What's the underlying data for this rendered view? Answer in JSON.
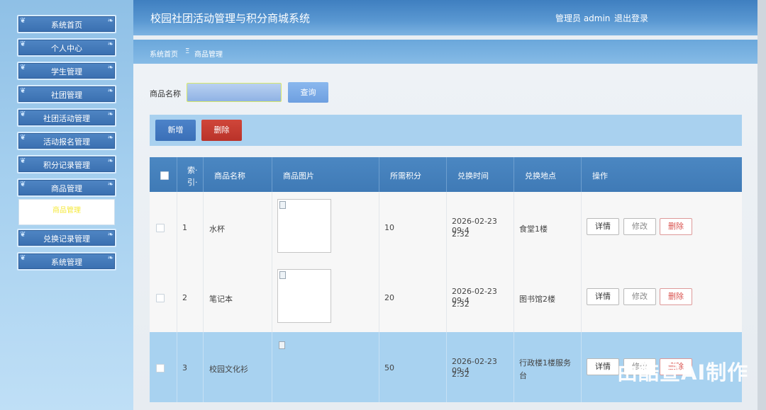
{
  "header": {
    "title": "校园社团活动管理与积分商城系统",
    "user": "管理员 admin",
    "logout": "退出登录"
  },
  "sidebar": {
    "items": [
      {
        "label": "系统首页"
      },
      {
        "label": "个人中心"
      },
      {
        "label": "学生管理"
      },
      {
        "label": "社团管理"
      },
      {
        "label": "社团活动管理"
      },
      {
        "label": "活动报名管理"
      },
      {
        "label": "积分记录管理"
      },
      {
        "label": "商品管理"
      },
      {
        "label": "兑换记录管理"
      },
      {
        "label": "系统管理"
      }
    ],
    "submenu_label": "商品管理"
  },
  "breadcrumb": {
    "home": "系统首页",
    "separator": "Ξ",
    "current": "商品管理"
  },
  "search": {
    "label": "商品名称",
    "value": "",
    "query_label": "查询"
  },
  "toolbar": {
    "add_label": "新增",
    "delete_label": "删除"
  },
  "table": {
    "columns": [
      "索引",
      "商品名称",
      "商品图片",
      "所需积分",
      "兑换时间",
      "兑换地点",
      "操作"
    ],
    "index_header_line1": "索·",
    "index_header_line2": "引·",
    "rows": [
      {
        "index": "1",
        "name": "水杯",
        "points": "10",
        "time_line1": "2026-02-23 09:4",
        "time_line2": "2:32",
        "place_line1": "食堂1楼",
        "place_line2": ""
      },
      {
        "index": "2",
        "name": "笔记本",
        "points": "20",
        "time_line1": "2026-02-23 09:4",
        "time_line2": "2:32",
        "place_line1": "图书馆2楼",
        "place_line2": ""
      },
      {
        "index": "3",
        "name": "校园文化衫",
        "points": "50",
        "time_line1": "2026-02-23 09:4",
        "time_line2": "2:32",
        "place_line1": "行政楼1楼服务",
        "place_line2": "台"
      }
    ],
    "actions": {
      "detail": "详情",
      "edit": "修改",
      "delete": "删除"
    }
  },
  "watermark": "由酷宣AI制作",
  "colors": {
    "header": "#4a88c6",
    "menu_button": "#3f74b4",
    "delete_red": "#c23a30",
    "toolbar_bg": "#a9d1ef",
    "table_header": "#4582bd"
  }
}
